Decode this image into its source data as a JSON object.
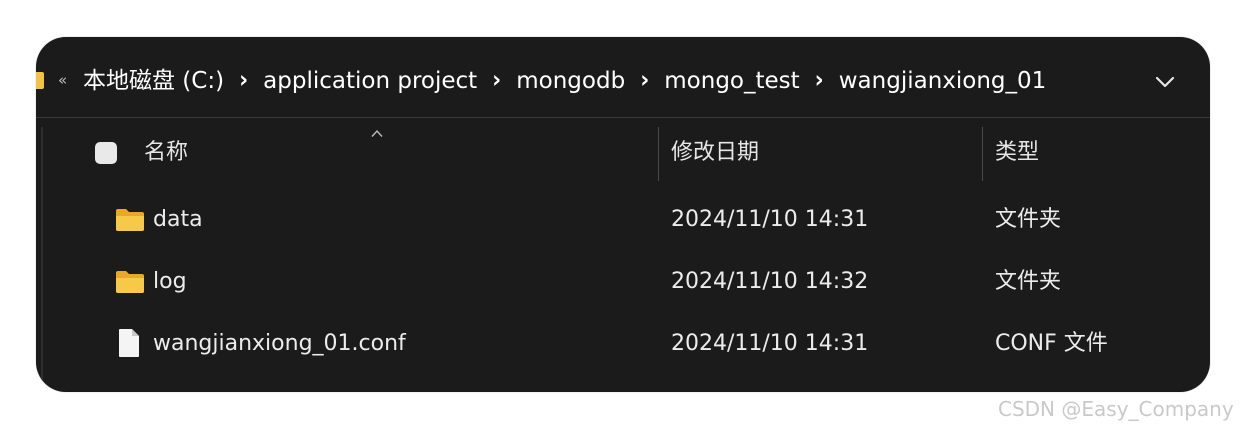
{
  "addressbar": {
    "overflow_glyph": "«",
    "breadcrumbs": [
      {
        "label": "本地磁盘 (C:)"
      },
      {
        "label": "application project"
      },
      {
        "label": "mongodb"
      },
      {
        "label": "mongo_test"
      },
      {
        "label": "wangjianxiong_01"
      }
    ],
    "separator": "›"
  },
  "columns": {
    "name": "名称",
    "modified": "修改日期",
    "type": "类型"
  },
  "files": [
    {
      "name": "data",
      "modified": "2024/11/10 14:31",
      "type": "文件夹",
      "icon": "folder-icon"
    },
    {
      "name": "log",
      "modified": "2024/11/10 14:32",
      "type": "文件夹",
      "icon": "folder-icon"
    },
    {
      "name": "wangjianxiong_01.conf",
      "modified": "2024/11/10 14:31",
      "type": "CONF 文件",
      "icon": "file-icon"
    }
  ],
  "watermark": "CSDN @Easy_Company",
  "colors": {
    "window_bg": "#1b1b1b",
    "folder": "#f5c343",
    "text": "#ececec"
  }
}
